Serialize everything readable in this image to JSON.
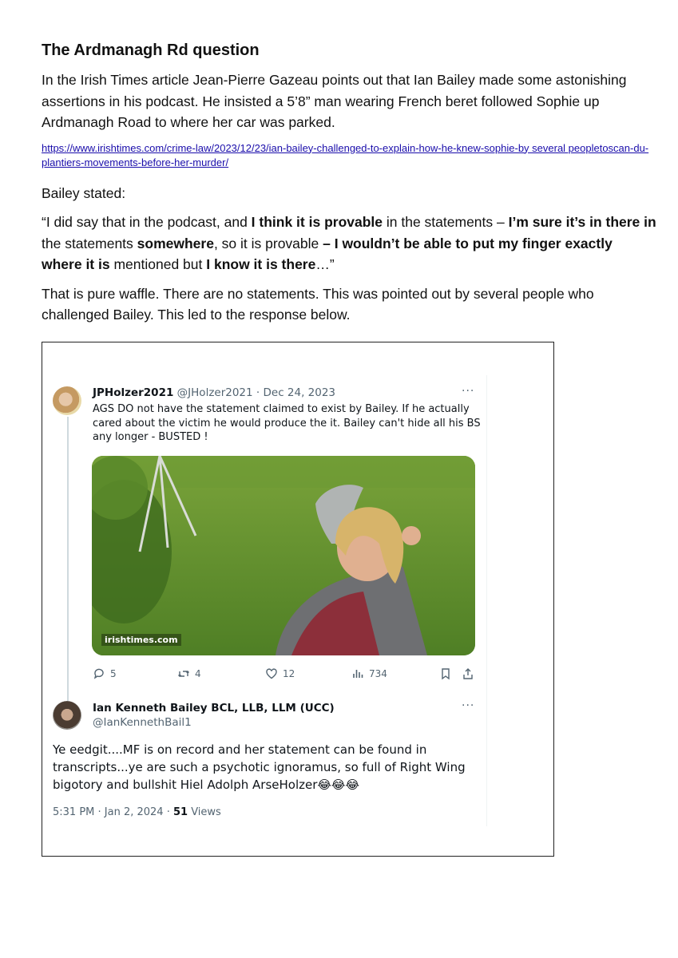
{
  "heading": "The Ardmanagh Rd question",
  "para1": "In the Irish Times article Jean-Pierre Gazeau  points out that Ian Bailey made some astonishing assertions in his podcast. He insisted a 5’8” man wearing  French beret followed Sophie up Ardmanagh Road to where her car was parked.",
  "link": "https://www.irishtimes.com/crime-law/2023/12/23/ian-bailey-challenged-to-explain-how-he-knew-sophie-by several peopletoscan-du-plantiers-movements-before-her-murder/",
  "para2": "Bailey stated:",
  "quote": {
    "q1": "“I did say that in the podcast, and ",
    "q2": "I think it is provable",
    "q3": " in the statements – ",
    "q4": "I’m sure it’s in there in",
    "q5": " the statements ",
    "q6": "somewhere",
    "q7": ", so it is provable ",
    "q8": "– I wouldn’t be able to put my finger exactly where it is",
    "q9": " mentioned but ",
    "q10": "I know it is there",
    "q11": "…”"
  },
  "para3": "That is pure waffle. There are no statements. This was pointed out by several people who challenged Bailey. This led to the response below.",
  "tweet1": {
    "name": "JPHolzer2021",
    "handle": "@JHolzer2021 · Dec 24, 2023",
    "more": "···",
    "text": "AGS DO not have the statement claimed to exist by Bailey. If he actually cared about the victim he would produce the it. Bailey can't hide all his BS any longer - BUSTED !",
    "photo_credit": "irishtimes.com",
    "replies": "5",
    "retweets": "4",
    "likes": "12",
    "views": "734"
  },
  "tweet2": {
    "name": "Ian Kenneth Bailey BCL, LLB, LLM (UCC)",
    "handle": "@IanKennethBail1",
    "more": "···",
    "text": "Ye eedgit....MF is on record and her statement can be found in transcripts...ye are such a psychotic ignoramus, so full of Right Wing bigotory  and bullshit Hiel Adolph ArseHolzer😂😂😂",
    "time": "5:31 PM · Jan 2, 2024 · ",
    "views_count": "51",
    "views_label": " Views"
  }
}
